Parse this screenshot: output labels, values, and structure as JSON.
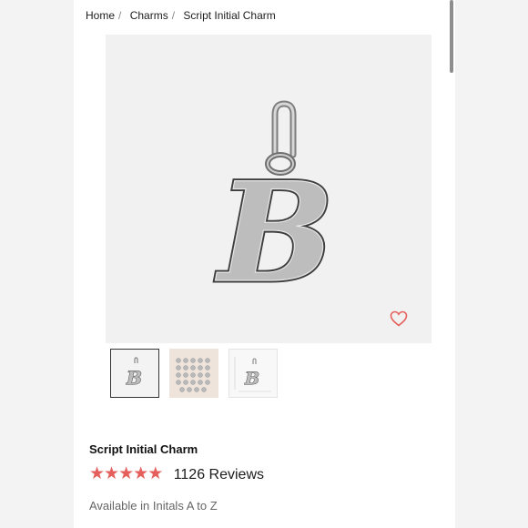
{
  "breadcrumb": {
    "items": [
      "Home",
      "Charms",
      "Script Initial Charm"
    ],
    "separator": "/"
  },
  "product": {
    "main_image_letter": "B",
    "title": "Script Initial Charm",
    "rating": {
      "stars": 5,
      "max": 5,
      "star_glyph": "★",
      "reviews": "1126 Reviews"
    },
    "availability": "Available in Initals A to Z"
  },
  "thumbnails": [
    {
      "name": "charm-front-thumbnail",
      "selected": true
    },
    {
      "name": "all-letters-thumbnail",
      "selected": false
    },
    {
      "name": "charm-dimensions-thumbnail",
      "selected": false
    }
  ],
  "icons": {
    "wishlist": "heart-icon"
  },
  "colors": {
    "accent": "#e5605c",
    "image_background": "#f1f1f1",
    "silver": "#b9b9b9"
  }
}
